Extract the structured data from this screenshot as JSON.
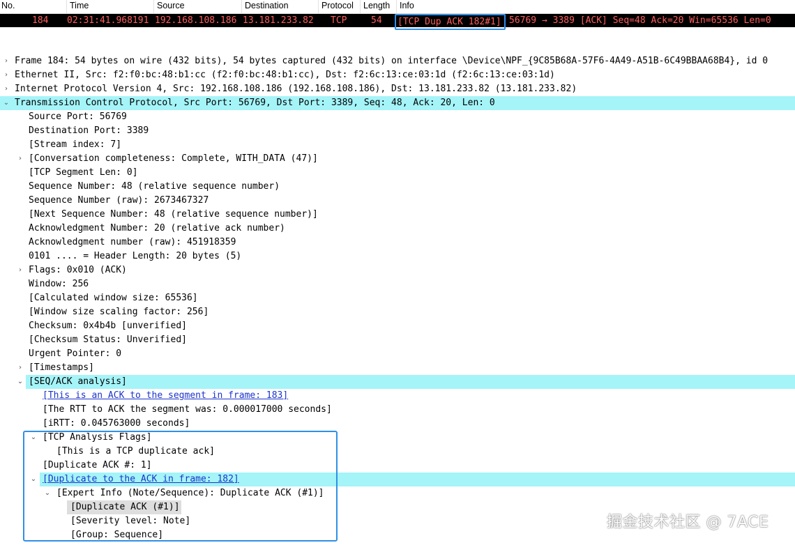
{
  "columns": [
    "No.",
    "Time",
    "Source",
    "Destination",
    "Protocol",
    "Length",
    "Info"
  ],
  "packet": {
    "no": "184",
    "time": "02:31:41.968191",
    "source": "192.168.108.186",
    "destination": "13.181.233.82",
    "protocol": "TCP",
    "length": "54",
    "info_flag": "[TCP Dup ACK 182#1]",
    "info_rest": "56769 → 3389 [ACK] Seq=48 Ack=20 Win=65536 Len=0"
  },
  "colors": {
    "packet_row_bg": "#000000",
    "packet_row_fg": "#ff5e5e",
    "selected_row_bg": "#a4f4f8",
    "highlight_border": "#2f8fe8",
    "link_color": "#1a33cc"
  },
  "tree": [
    "Frame 184: 54 bytes on wire (432 bits), 54 bytes captured (432 bits) on interface \\Device\\NPF_{9C85B68A-57F6-4A49-A51B-6C49BBAA68B4}, id 0",
    "Ethernet II, Src: f2:f0:bc:48:b1:cc (f2:f0:bc:48:b1:cc), Dst: f2:6c:13:ce:03:1d (f2:6c:13:ce:03:1d)",
    "Internet Protocol Version 4, Src: 192.168.108.186 (192.168.108.186), Dst: 13.181.233.82 (13.181.233.82)",
    "Transmission Control Protocol, Src Port: 56769, Dst Port: 3389, Seq: 48, Ack: 20, Len: 0",
    "Source Port: 56769",
    "Destination Port: 3389",
    "[Stream index: 7]",
    "[Conversation completeness: Complete, WITH_DATA (47)]",
    "[TCP Segment Len: 0]",
    "Sequence Number: 48    (relative sequence number)",
    "Sequence Number (raw): 2673467327",
    "[Next Sequence Number: 48    (relative sequence number)]",
    "Acknowledgment Number: 20    (relative ack number)",
    "Acknowledgment number (raw): 451918359",
    "0101 .... = Header Length: 20 bytes (5)",
    "Flags: 0x010 (ACK)",
    "Window: 256",
    "[Calculated window size: 65536]",
    "[Window size scaling factor: 256]",
    "Checksum: 0x4b4b [unverified]",
    "[Checksum Status: Unverified]",
    "Urgent Pointer: 0",
    "[Timestamps]",
    "[SEQ/ACK analysis]",
    "[This is an ACK to the segment in frame: 183]",
    "[The RTT to ACK the segment was: 0.000017000 seconds]",
    "[iRTT: 0.045763000 seconds]",
    "[TCP Analysis Flags]",
    "[This is a TCP duplicate ack]",
    "[Duplicate ACK #: 1]",
    "[Duplicate to the ACK in frame: 182]",
    "[Expert Info (Note/Sequence): Duplicate ACK (#1)]",
    "[Duplicate ACK (#1)]",
    "[Severity level: Note]",
    "[Group: Sequence]"
  ],
  "watermark": "掘金技术社区 @ 7ACE"
}
